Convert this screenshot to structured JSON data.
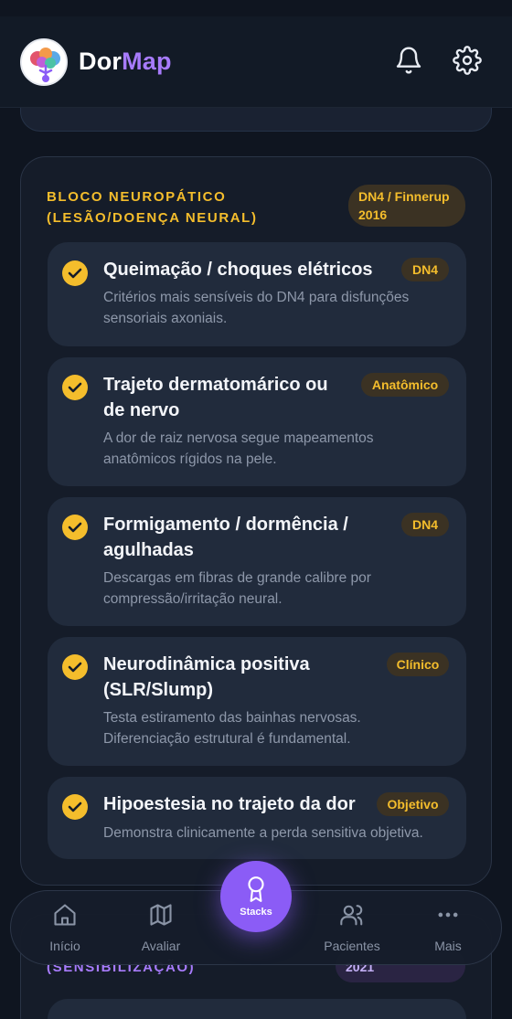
{
  "app": {
    "brand_part1": "Dor",
    "brand_part2": "Map"
  },
  "header": {
    "icons": [
      "bell-icon",
      "gear-icon"
    ]
  },
  "section": {
    "title": "BLOCO NEUROPÁTICO (LESÃO/DOENÇA NEURAL)",
    "badge_line1": "DN4 / Finnerup",
    "badge_line2": "2016",
    "items": [
      {
        "title": "Queimação / choques elétricos",
        "tag": "DN4",
        "desc": "Critérios mais sensíveis do DN4 para disfunções sensoriais axoniais.",
        "checked": true
      },
      {
        "title": "Trajeto dermatomárico ou de nervo",
        "tag": "Anatômico",
        "desc": "A dor de raiz nervosa segue mapeamentos anatômicos rígidos na pele.",
        "checked": true
      },
      {
        "title": "Formigamento / dormência / agulhadas",
        "tag": "DN4",
        "desc": "Descargas em fibras de grande calibre por compressão/irritação neural.",
        "checked": true
      },
      {
        "title": "Neurodinâmica positiva (SLR/Slump)",
        "tag": "Clínico",
        "desc": "Testa estiramento das bainhas nervosas. Diferenciação estrutural é fundamental.",
        "checked": true
      },
      {
        "title": "Hipoestesia no trajeto da dor",
        "tag": "Objetivo",
        "desc": "Demonstra clinicamente a perda sensitiva objetiva.",
        "checked": true
      }
    ]
  },
  "next_section": {
    "title": "(SENSIBILIZAÇÃO)",
    "badge": "2021"
  },
  "nav": {
    "items": [
      {
        "label": "Início",
        "icon": "home-icon"
      },
      {
        "label": "Avaliar",
        "icon": "map-icon"
      },
      {
        "label": "Pacientes",
        "icon": "users-icon"
      },
      {
        "label": "Mais",
        "icon": "more-icon"
      }
    ],
    "fab_label": "Stacks",
    "fab_icon": "award-icon"
  },
  "colors": {
    "accent": "#f4bd2c",
    "brand": "#a77bfb",
    "fab": "#8b5cf6",
    "background": "#0f1520"
  }
}
